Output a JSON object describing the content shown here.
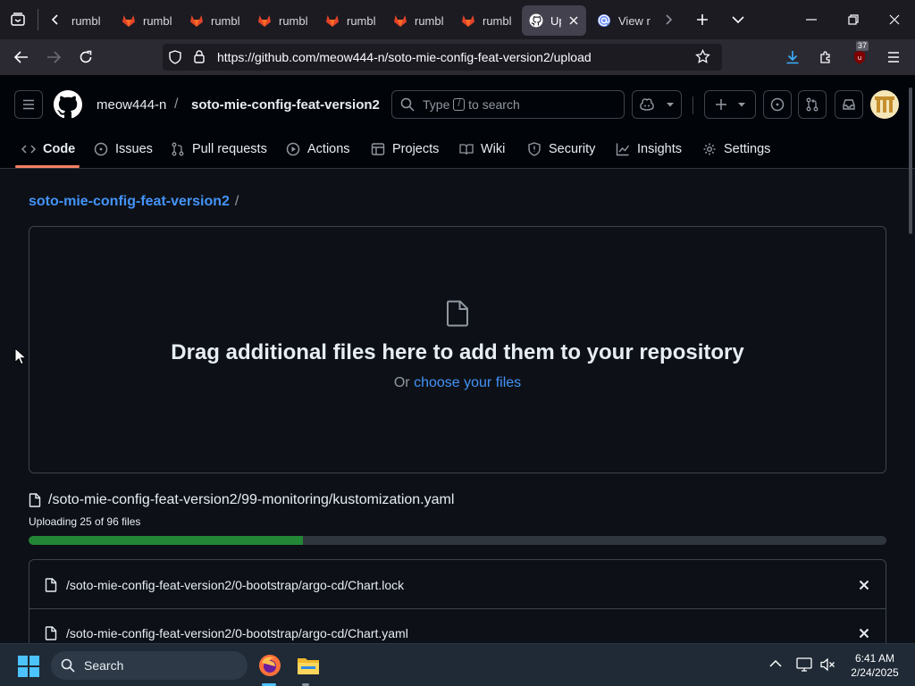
{
  "browser": {
    "tabs": [
      {
        "label": "rumbl",
        "icon": "gitlab-icon"
      },
      {
        "label": "rumbl",
        "icon": "gitlab-icon"
      },
      {
        "label": "rumbl",
        "icon": "gitlab-icon"
      },
      {
        "label": "rumbl",
        "icon": "gitlab-icon"
      },
      {
        "label": "rumbl",
        "icon": "gitlab-icon"
      },
      {
        "label": "rumbl",
        "icon": "gitlab-icon"
      },
      {
        "label": "rumbl",
        "icon": "gitlab-icon"
      }
    ],
    "active_tab": {
      "label": "Upl",
      "icon": "github-icon"
    },
    "next_tab": {
      "label": "View r"
    },
    "url": "https://github.com/meow444-n/soto-mie-config-feat-version2/upload",
    "extension_badge": "37"
  },
  "github": {
    "owner": "meow444-n",
    "separator": "/",
    "repo": "soto-mie-config-feat-version2",
    "search": {
      "before": "Type",
      "key": "/",
      "after": "to search"
    },
    "nav": [
      {
        "label": "Code",
        "icon": "code-icon"
      },
      {
        "label": "Issues",
        "icon": "issue-icon"
      },
      {
        "label": "Pull requests",
        "icon": "pull-request-icon"
      },
      {
        "label": "Actions",
        "icon": "play-icon"
      },
      {
        "label": "Projects",
        "icon": "table-icon"
      },
      {
        "label": "Wiki",
        "icon": "book-icon"
      },
      {
        "label": "Security",
        "icon": "shield-icon"
      },
      {
        "label": "Insights",
        "icon": "graph-icon"
      },
      {
        "label": "Settings",
        "icon": "gear-icon"
      }
    ]
  },
  "upload": {
    "breadcrumb_repo": "soto-mie-config-feat-version2",
    "breadcrumb_sep": "/",
    "drop_title": "Drag additional files here to add them to your repository",
    "drop_or": "Or",
    "drop_link": "choose your files",
    "current_file": "/soto-mie-config-feat-version2/99-monitoring/kustomization.yaml",
    "status": "Uploading 25 of 96 files",
    "progress_percent": 32,
    "files": [
      "/soto-mie-config-feat-version2/0-bootstrap/argo-cd/Chart.lock",
      "/soto-mie-config-feat-version2/0-bootstrap/argo-cd/Chart.yaml"
    ]
  },
  "taskbar": {
    "search_label": "Search",
    "time": "6:41 AM",
    "date": "2/24/2025"
  },
  "colors": {
    "accent_link": "#4493f8",
    "progress_fill": "#238636",
    "tab_underline": "#f78166"
  }
}
